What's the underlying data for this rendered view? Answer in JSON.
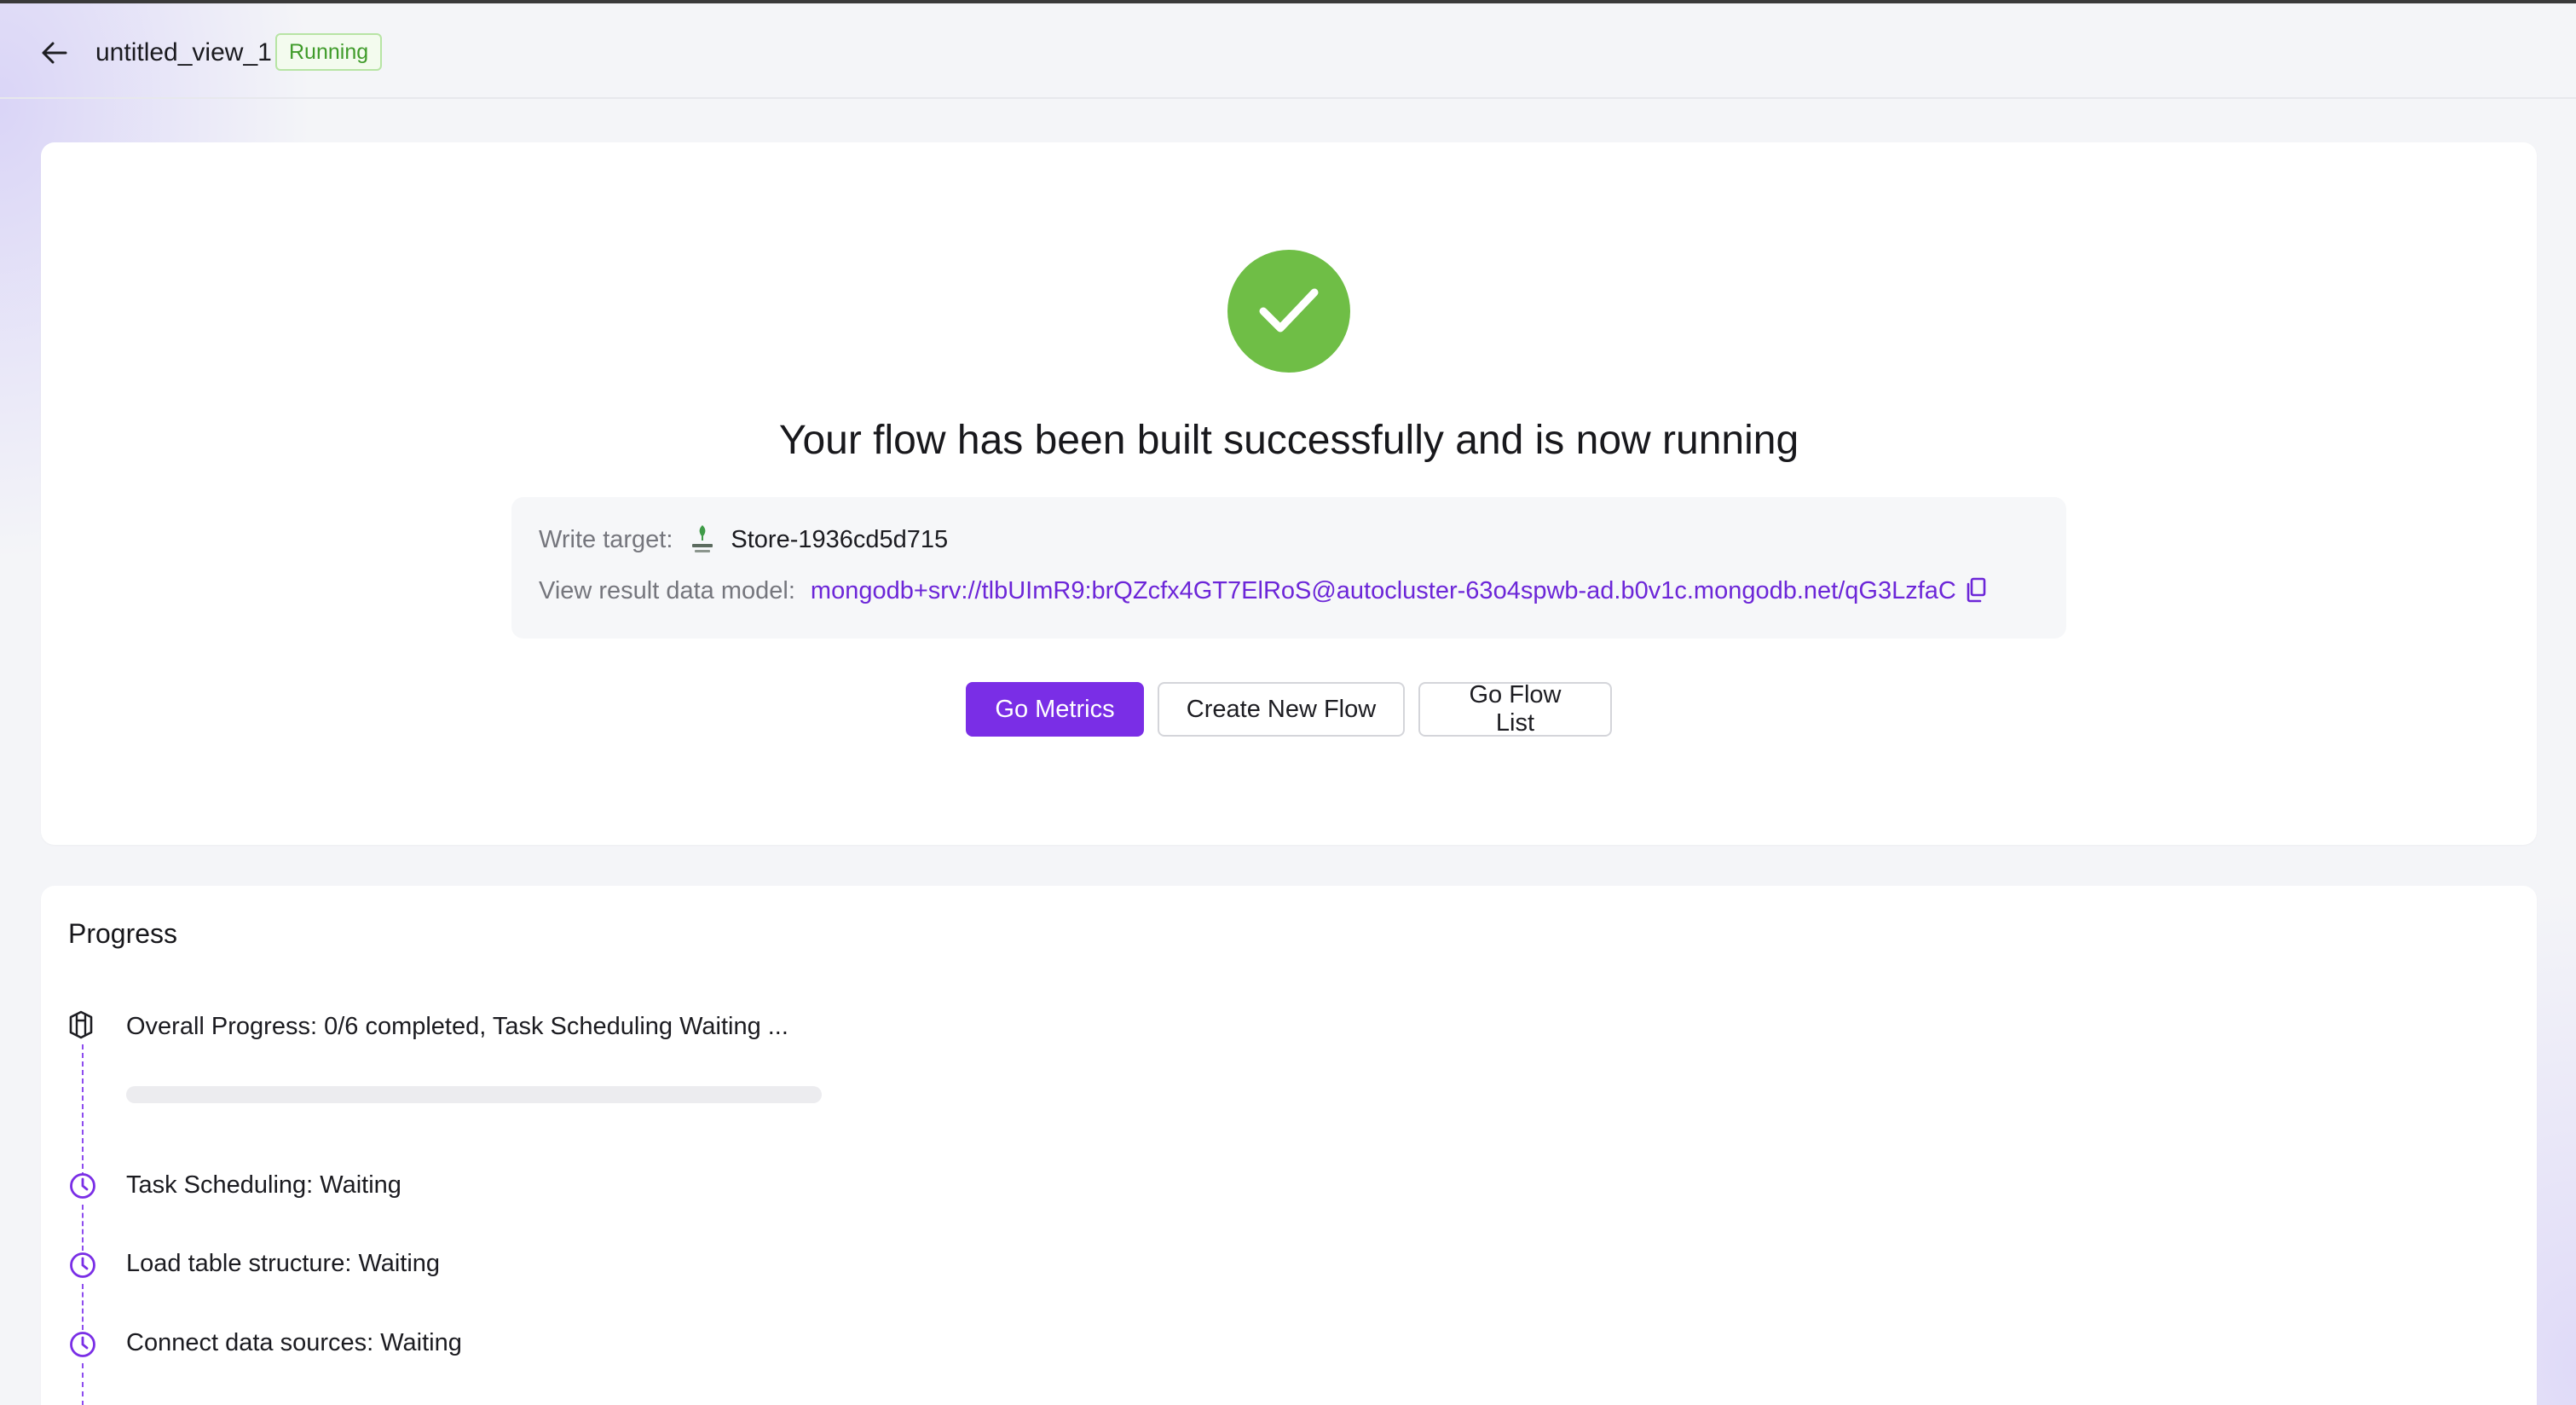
{
  "header": {
    "back_icon": "arrow-left-icon",
    "title": "untitled_view_1",
    "status": "Running"
  },
  "success": {
    "icon": "check-circle-icon",
    "headline": "Your flow has been built successfully and is now running",
    "write_target_label": "Write target:",
    "write_target_icon": "atlas-logo-icon",
    "write_target_value": "Store-1936cd5d715",
    "result_model_label": "View result data model:",
    "result_model_value": "mongodb+srv://tlbUImR9:brQZcfx4GT7ElRoS@autocluster-63o4spwb-ad.b0v1c.mongodb.net/qG3LzfaC",
    "copy_icon": "copy-icon"
  },
  "actions": {
    "go_metrics": "Go Metrics",
    "create_new_flow": "Create New Flow",
    "go_flow_list": "Go Flow List"
  },
  "progress": {
    "title": "Progress",
    "overall_text": "Overall Progress: 0/6 completed, Task Scheduling Waiting ...",
    "overall_fraction": 0,
    "steps": [
      {
        "label": "Task Scheduling: Waiting",
        "icon": "clock-icon"
      },
      {
        "label": "Load table structure: Waiting",
        "icon": "clock-icon"
      },
      {
        "label": "Connect data sources: Waiting",
        "icon": "clock-icon"
      }
    ]
  },
  "colors": {
    "accent": "#7a2ee6",
    "success": "#6fbe46",
    "status_running": "#3f9b2a",
    "link": "#6c26d8"
  }
}
